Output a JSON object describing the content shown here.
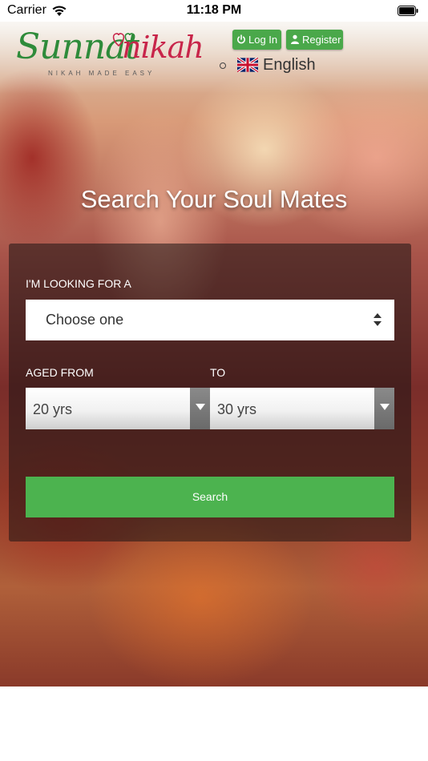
{
  "status_bar": {
    "carrier": "Carrier",
    "time": "11:18 PM",
    "icons": [
      "wifi-icon",
      "battery-icon"
    ]
  },
  "header": {
    "logo": {
      "name_part1": "Sunnat",
      "name_part2": "nikah",
      "tagline": "NIKAH MADE EASY"
    },
    "login_label": "Log In",
    "register_label": "Register",
    "language": "English"
  },
  "hero": {
    "headline": "Search Your Soul Mates"
  },
  "search_form": {
    "looking_for_label": "I'M LOOKING FOR A",
    "looking_for_value": "Choose one",
    "aged_from_label": "AGED FROM",
    "to_label": "TO",
    "age_from_value": "20 yrs",
    "age_to_value": "30 yrs",
    "search_label": "Search"
  },
  "colors": {
    "primary_green": "#4cb34f",
    "logo_green": "#2e8b3a",
    "logo_red": "#c8254a"
  }
}
